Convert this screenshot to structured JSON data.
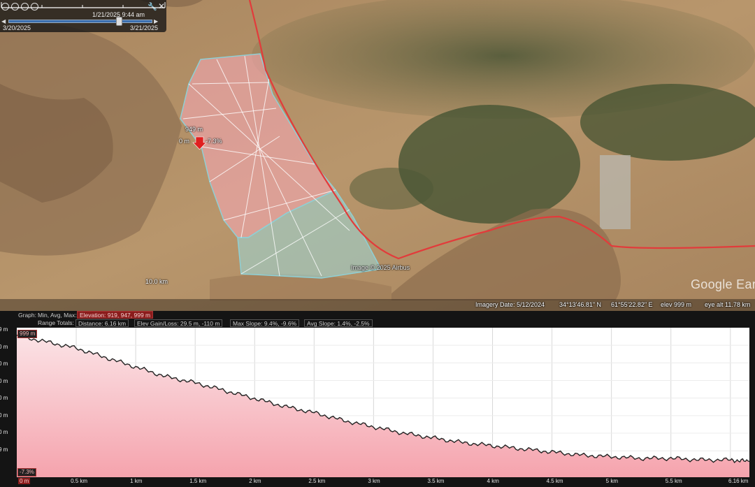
{
  "time_slider": {
    "current_time": "1/21/2025  9:44 am",
    "start_date": "3/20/2025",
    "end_date": "3/21/2025"
  },
  "map": {
    "placemark_elevation": "949 m",
    "placemark_left": "0 m",
    "placemark_slope": "-7.3%",
    "scale_label": "10.0 km",
    "image_credit": "Image © 2025 Airbus",
    "logo": "Google Earth",
    "status": {
      "imagery_date": "Imagery Date: 5/12/2024",
      "latitude": "34°13'46.81\" N",
      "longitude": "61°55'22.82\" E",
      "elev": "elev   999 m",
      "eye_alt": "eye alt  11.78 km"
    },
    "colors": {
      "boundary_line": "#e23b3b",
      "polygon_pink": "#f2a7b0",
      "polygon_teal": "#9fd3d0"
    }
  },
  "profile": {
    "header": {
      "graph_label": "Graph:",
      "minavgmax_label": "Min, Avg, Max:",
      "elevation": "Elevation: 919, 947, 999 m",
      "range_totals_label": "Range Totals:",
      "distance": "Distance: 6.16 km",
      "elev_gain_loss": "Elev Gain/Loss: 29.5 m, -110 m",
      "max_slope": "Max Slope: 9.4%, -9.6%",
      "avg_slope": "Avg Slope: 1.4%, -2.5%"
    },
    "cursor_top": "999 m",
    "cursor_bottom": "-7.3%",
    "y_ticks": [
      "9 m",
      "0 m",
      "0 m",
      "0 m",
      "0 m",
      "0 m",
      "0 m",
      "9 m"
    ],
    "x_ticks": [
      "0 m",
      "0.5 km",
      "1 km",
      "1.5 km",
      "2 km",
      "2.5 km",
      "3 km",
      "3.5 km",
      "4 km",
      "4.5 km",
      "5 km",
      "5.5 km",
      "6.16 km"
    ]
  },
  "chart_data": {
    "type": "area",
    "x_unit": "km",
    "y_unit": "m",
    "xlim": [
      0,
      6.16
    ],
    "ylim": [
      909,
      1004
    ],
    "x": [
      0,
      0.25,
      0.5,
      0.75,
      1.0,
      1.25,
      1.5,
      1.75,
      2.0,
      2.25,
      2.5,
      2.75,
      3.0,
      3.25,
      3.5,
      3.75,
      4.0,
      4.25,
      4.5,
      4.75,
      5.0,
      5.25,
      5.5,
      5.75,
      6.0,
      6.16
    ],
    "y": [
      999,
      995,
      991,
      985,
      979,
      973,
      969,
      964,
      959,
      954,
      950,
      945,
      941,
      937,
      934,
      931,
      929,
      927,
      925,
      923,
      922,
      921,
      921,
      920,
      920,
      919
    ]
  }
}
